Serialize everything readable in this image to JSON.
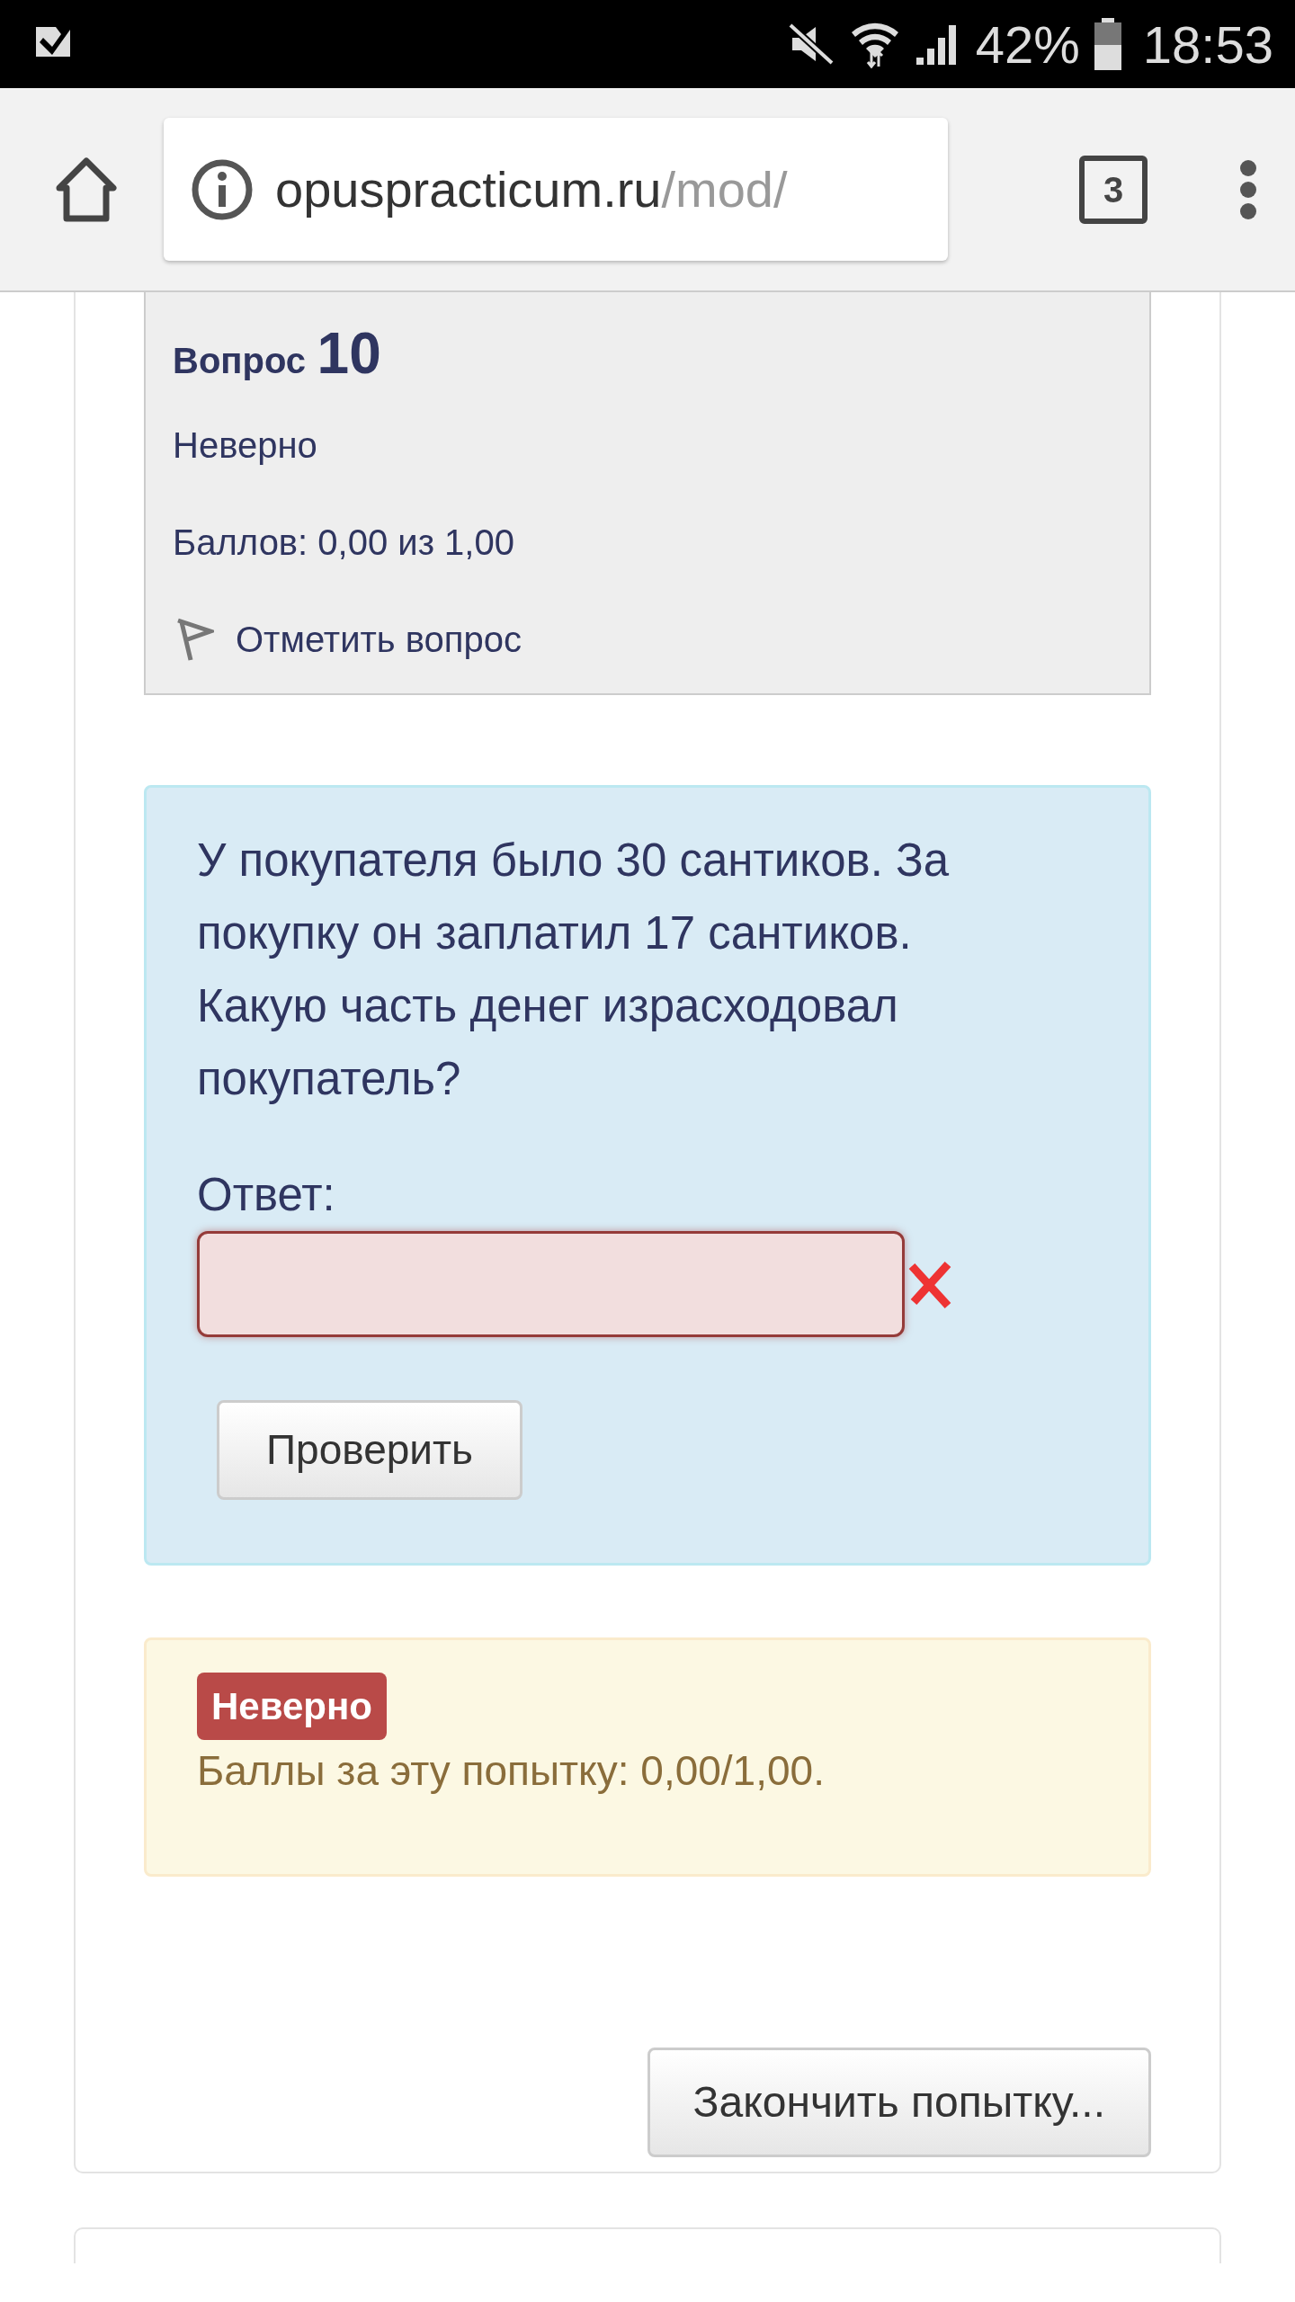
{
  "status_bar": {
    "battery": "42%",
    "time": "18:53"
  },
  "browser": {
    "url_domain": "opuspracticum.ru",
    "url_path": "/mod/",
    "tab_count": "3"
  },
  "question_info": {
    "label": "Вопрос",
    "number": "10",
    "state": "Неверно",
    "grade": "Баллов: 0,00 из 1,00",
    "flag_label": "Отметить вопрос",
    "flagged": false
  },
  "question": {
    "text": "У покупателя было 30 сантиков. За покупку он заплатил 17 сантиков. Какую часть денег израсходовал покупатель?",
    "answer_label": "Ответ:",
    "answer_correct": false,
    "check_button": "Проверить"
  },
  "feedback": {
    "badge": "Неверно",
    "badge_correct": false,
    "text": "Баллы за эту попытку: 0,00/1,00."
  },
  "finish_button": "Закончить попытку..."
}
